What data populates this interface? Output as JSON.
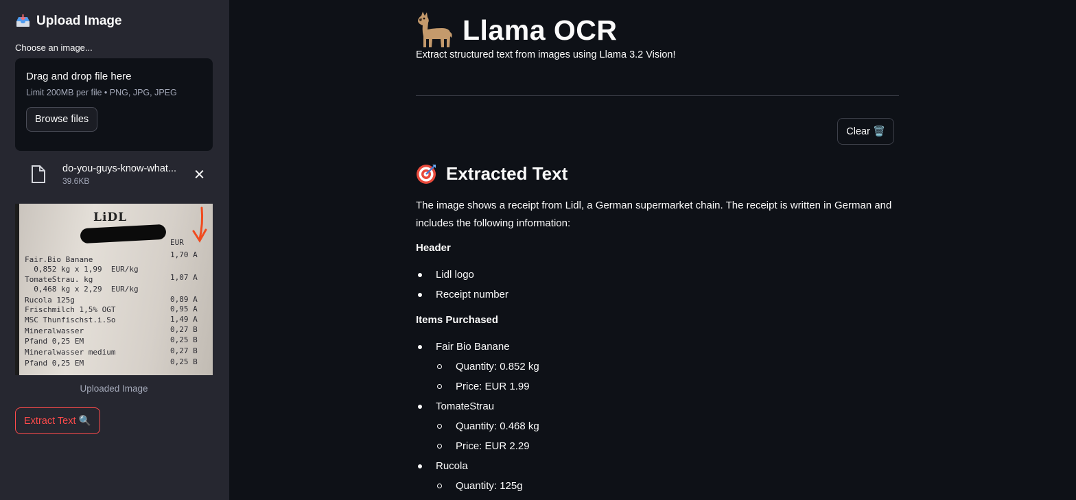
{
  "sidebar": {
    "header_icon": "inbox-tray-icon",
    "title": "Upload Image",
    "uploader_label": "Choose an image...",
    "dropzone": {
      "title": "Drag and drop file here",
      "limit": "Limit 200MB per file • PNG, JPG, JPEG",
      "browse_label": "Browse files"
    },
    "file": {
      "icon": "file-icon",
      "name": "do-you-guys-know-what...",
      "size": "39.6KB"
    },
    "preview": {
      "logo": "LiDL",
      "currency": "EUR",
      "lines": [
        {
          "text": "Fair.Bio Banane",
          "price": "1,70 A"
        },
        {
          "text": "  0,852 kg x 1,99  EUR/kg",
          "price": ""
        },
        {
          "text": "TomateStrau. kg",
          "price": "1,07 A"
        },
        {
          "text": "  0,468 kg x 2,29  EUR/kg",
          "price": ""
        },
        {
          "text": "Rucola 125g",
          "price": "0,89 A"
        },
        {
          "text": "Frischmilch 1,5% OGT",
          "price": "0,95 A"
        },
        {
          "text": "MSC Thunfischst.i.So",
          "price": "1,49 A"
        },
        {
          "text": "Mineralwasser",
          "price": "0,27 B"
        },
        {
          "text": "Pfand 0,25 EM",
          "price": "0,25 B"
        },
        {
          "text": "Mineralwasser medium",
          "price": "0,27 B"
        },
        {
          "text": "Pfand 0,25 EM",
          "price": "0,25 B"
        }
      ]
    },
    "caption": "Uploaded Image",
    "extract_label": "Extract Text 🔍"
  },
  "main": {
    "title_icon": "llama-icon",
    "title": "Llama OCR",
    "subtitle": "Extract structured text from images using Llama 3.2 Vision!",
    "clear_label": "Clear 🗑️",
    "section_icon": "target-icon",
    "section_title": "Extracted Text",
    "intro": "The image shows a receipt from Lidl, a German supermarket chain. The receipt is written in German and includes the following information:",
    "header_label": "Header",
    "header_items": [
      "Lidl logo",
      "Receipt number"
    ],
    "items_label": "Items Purchased",
    "items": [
      {
        "name": "Fair Bio Banane",
        "details": [
          "Quantity: 0.852 kg",
          "Price: EUR 1.99"
        ]
      },
      {
        "name": "TomateStrau",
        "details": [
          "Quantity: 0.468 kg",
          "Price: EUR 2.29"
        ]
      },
      {
        "name": "Rucola",
        "details": [
          "Quantity: 125g"
        ]
      }
    ]
  },
  "colors": {
    "sidebar_bg": "#262730",
    "main_bg": "#0e1117",
    "accent": "#ff4b4b",
    "text": "#fafafa",
    "muted": "#a3a8b8"
  }
}
